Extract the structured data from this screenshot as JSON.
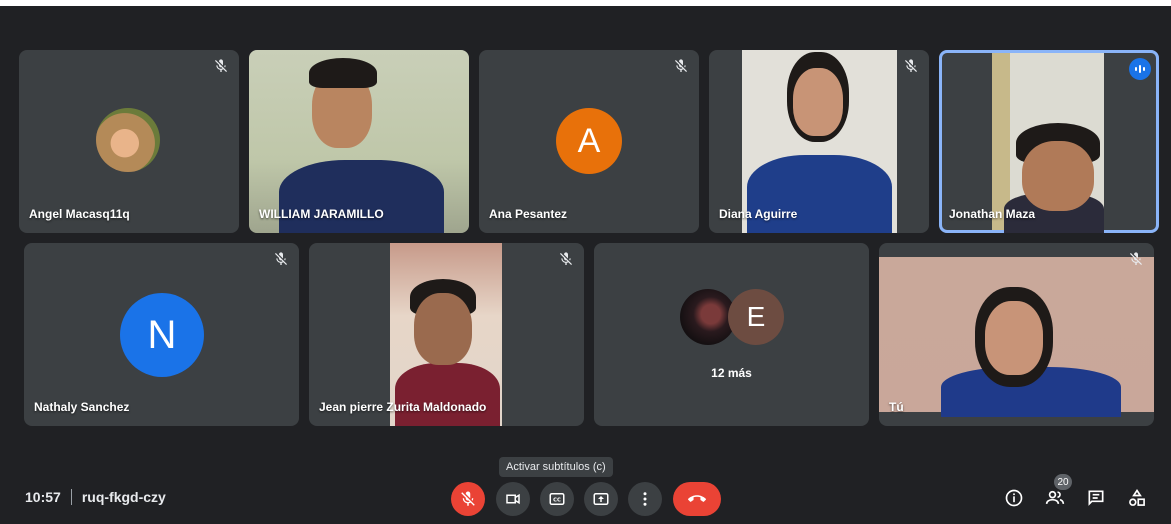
{
  "meeting": {
    "time": "10:57",
    "code": "ruq-fkgd-czy"
  },
  "tooltip": "Activar subtítulos (c)",
  "participants_badge": "20",
  "tiles": [
    {
      "name": "Angel Macasq11q"
    },
    {
      "name": "WILLIAM JARAMILLO"
    },
    {
      "name": "Ana Pesantez",
      "initial": "A",
      "color": "#e8710a"
    },
    {
      "name": "Diana Aguirre"
    },
    {
      "name": "Jonathan Maza"
    },
    {
      "name": "Nathaly Sanchez",
      "initial": "N",
      "color": "#1a73e8"
    },
    {
      "name": "Jean pierre Zurita Maldonado"
    },
    {
      "name": "12 más",
      "initial": "E",
      "color": "#6d4c41"
    },
    {
      "name": "Tú"
    }
  ],
  "controls": {
    "mic": "microphone-off",
    "camera": "camera",
    "captions": "captions",
    "present": "present-screen",
    "more": "more-options",
    "leave": "leave-call"
  },
  "right_controls": [
    "info",
    "people",
    "chat",
    "activities"
  ]
}
